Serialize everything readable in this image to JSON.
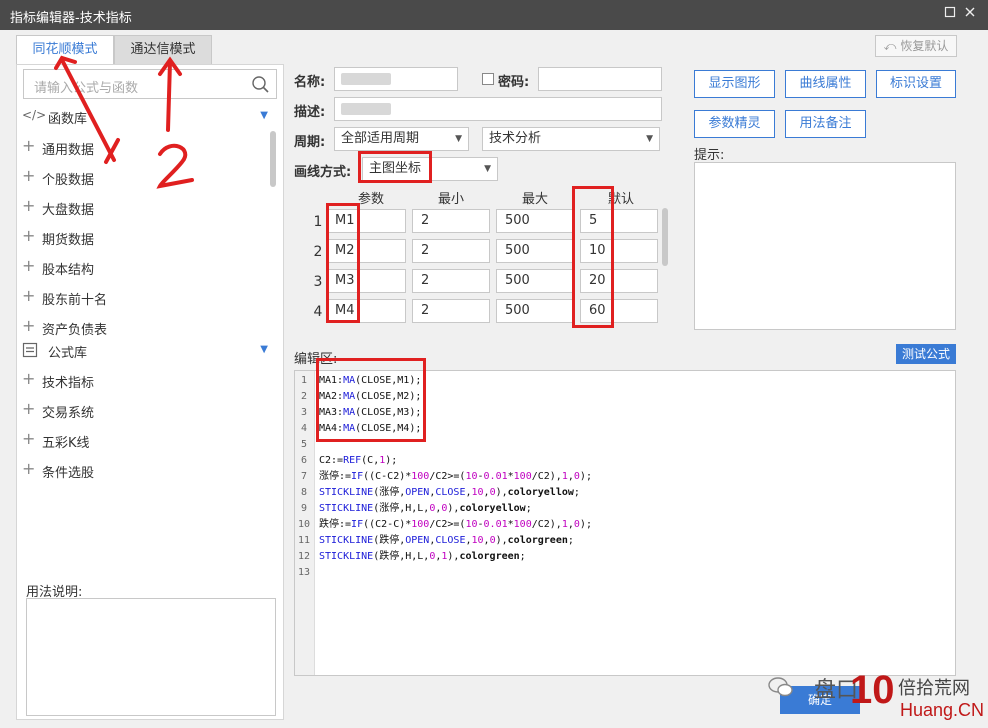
{
  "window": {
    "title": "指标编辑器-技术指标"
  },
  "tabs": [
    {
      "label": "同花顺模式"
    },
    {
      "label": "通达信模式"
    }
  ],
  "toolbar": {
    "restore_label": "恢复默认"
  },
  "search": {
    "placeholder": "请输入公式与函数"
  },
  "function_lib": {
    "label": "函数库",
    "items": [
      "通用数据",
      "个股数据",
      "大盘数据",
      "期货数据",
      "股本结构",
      "股东前十名",
      "资产负债表"
    ]
  },
  "formula_lib": {
    "label": "公式库",
    "items": [
      "技术指标",
      "交易系统",
      "五彩K线",
      "条件选股"
    ]
  },
  "usage": {
    "label": "用法说明:"
  },
  "form": {
    "name_label": "名称:",
    "password_label": "密码:",
    "desc_label": "描述:",
    "period_label": "周期:",
    "period_value": "全部适用周期",
    "category_value": "技术分析",
    "draw_mode_label": "画线方式:",
    "draw_mode_value": "主图坐标"
  },
  "buttons": {
    "show_graph": "显示图形",
    "curve_props": "曲线属性",
    "marker_settings": "标识设置",
    "param_wizard": "参数精灵",
    "usage_notes": "用法备注",
    "test_formula": "测试公式",
    "confirm": "确定"
  },
  "hint": {
    "label": "提示:"
  },
  "params": {
    "headers": [
      "参数",
      "最小",
      "最大",
      "默认"
    ],
    "rows": [
      {
        "index": "1",
        "name": "M1",
        "min": "2",
        "max": "500",
        "default": "5"
      },
      {
        "index": "2",
        "name": "M2",
        "min": "2",
        "max": "500",
        "default": "10"
      },
      {
        "index": "3",
        "name": "M3",
        "min": "2",
        "max": "500",
        "default": "20"
      },
      {
        "index": "4",
        "name": "M4",
        "min": "2",
        "max": "500",
        "default": "60"
      }
    ]
  },
  "editor": {
    "label": "编辑区:",
    "line_numbers": [
      "1",
      "2",
      "3",
      "4",
      "5",
      "6",
      "7",
      "8",
      "9",
      "10",
      "11",
      "12",
      "13"
    ]
  },
  "annotations": {
    "arrow1": "1",
    "arrow2": "2"
  },
  "watermark": {
    "text1": "盘口",
    "text2": "10",
    "text3": "倍拾荒网",
    "text4": "Huang.CN"
  },
  "colors": {
    "accent": "#3a7bd5",
    "annotation_red": "#e02020",
    "titlebar": "#4a4a4a"
  }
}
